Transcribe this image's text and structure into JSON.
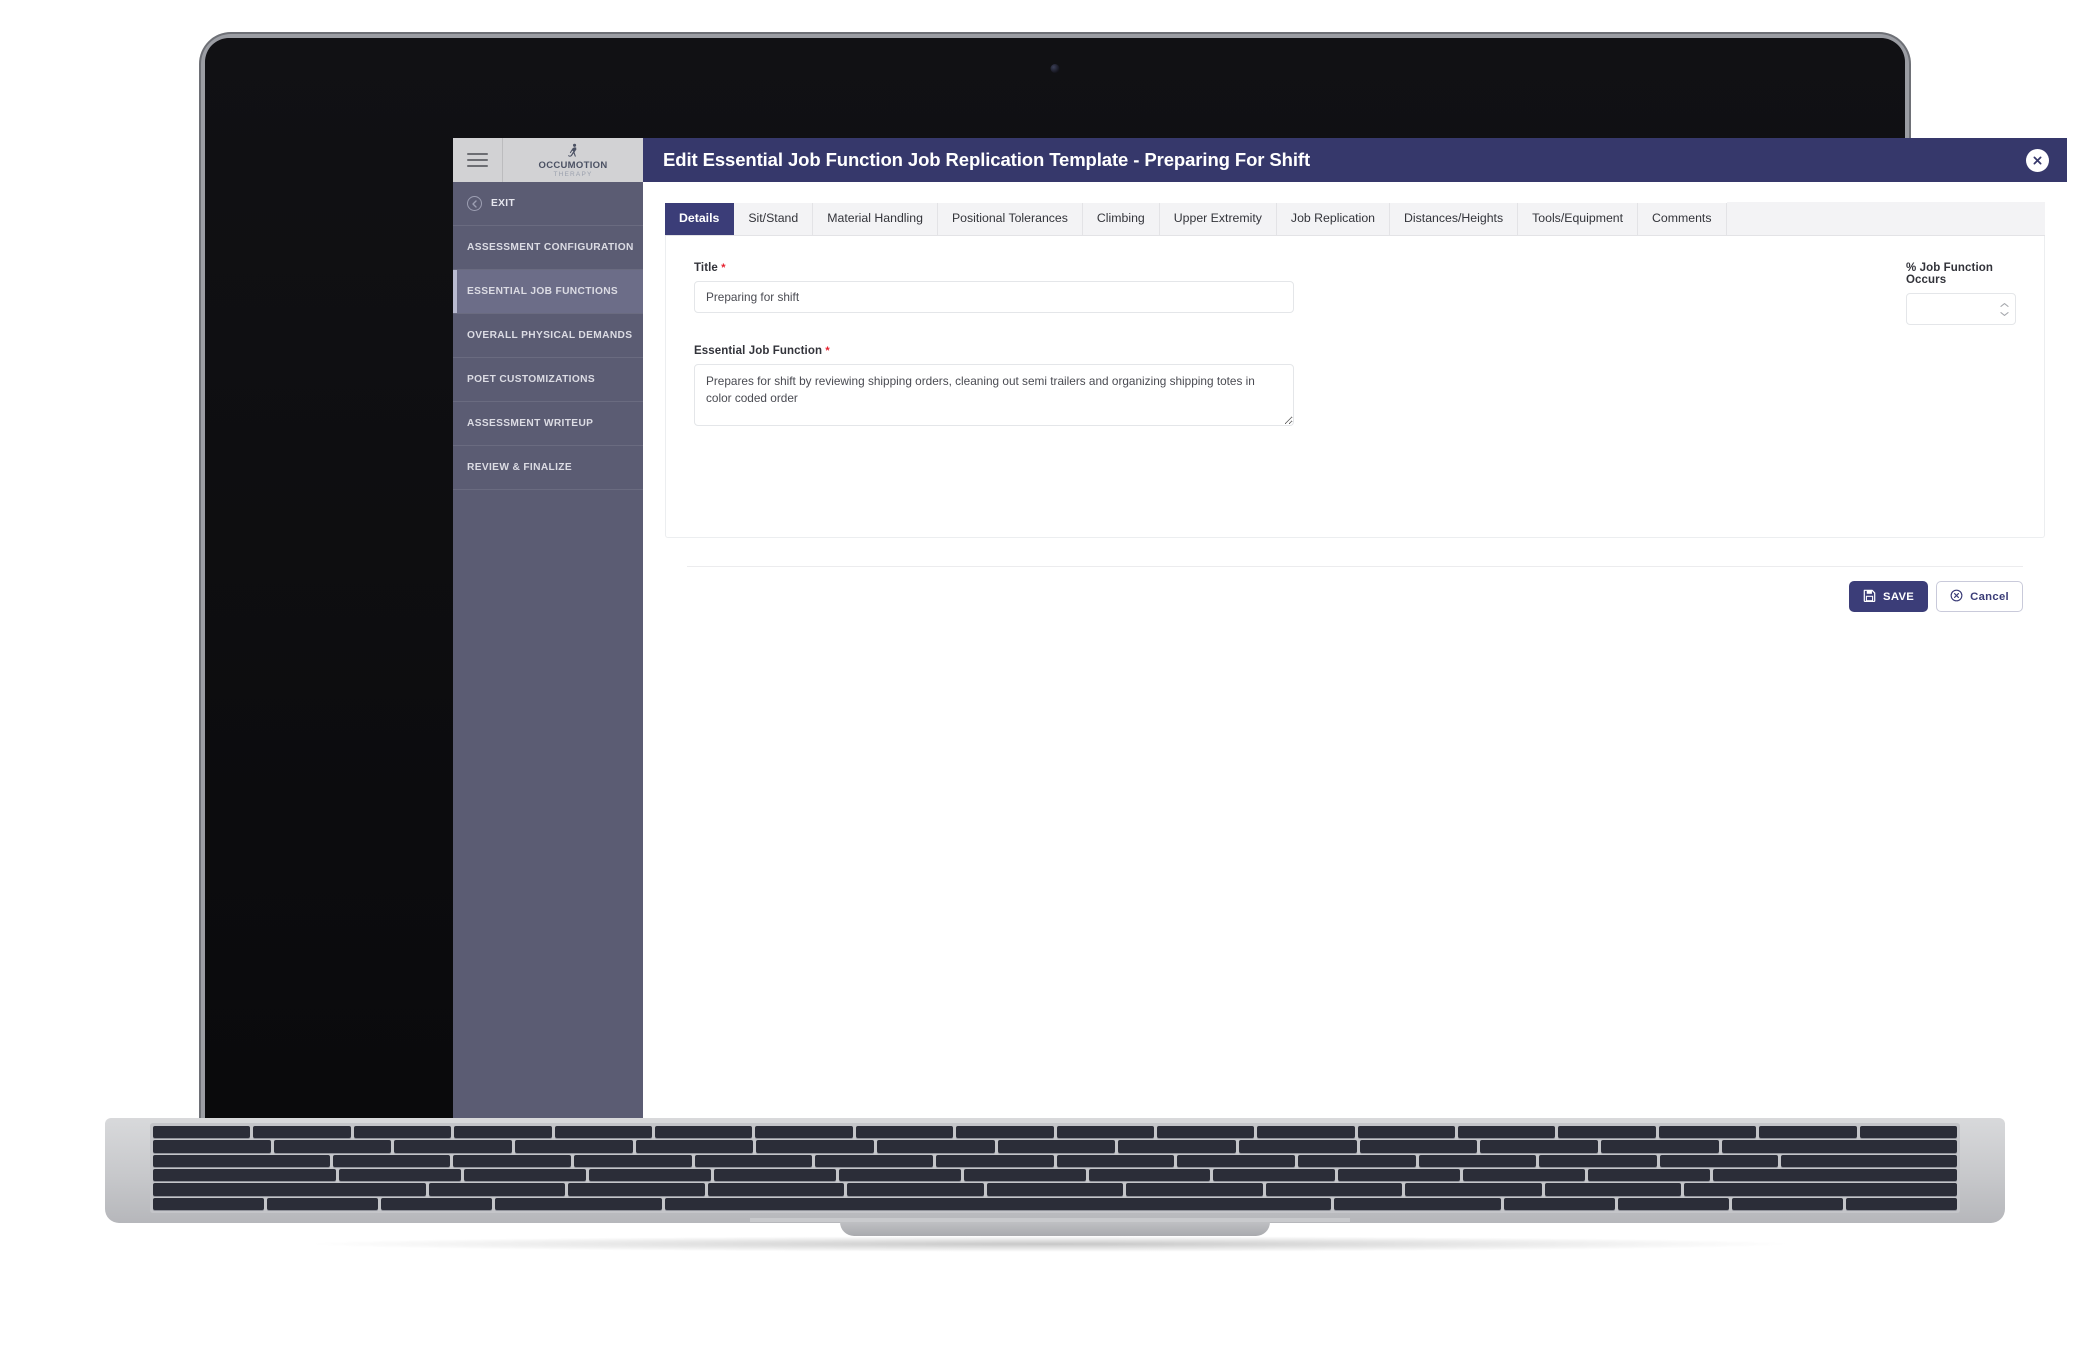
{
  "sidebar": {
    "brand": {
      "name": "OCCUMOTION",
      "tagline": "THERAPY",
      "logo_icon": "person-figure-icon"
    },
    "menu_icon": "hamburger-menu-icon",
    "items": [
      {
        "label": "EXIT",
        "icon": "back-arrow-circle-icon",
        "active": false
      },
      {
        "label": "ASSESSMENT CONFIGURATION",
        "active": false
      },
      {
        "label": "ESSENTIAL JOB FUNCTIONS",
        "active": true
      },
      {
        "label": "OVERALL PHYSICAL DEMANDS",
        "active": false
      },
      {
        "label": "POET CUSTOMIZATIONS",
        "active": false
      },
      {
        "label": "ASSESSMENT WRITEUP",
        "active": false
      },
      {
        "label": "REVIEW & FINALIZE",
        "active": false
      }
    ]
  },
  "titlebar": {
    "title": "Edit Essential Job Function Job Replication Template - Preparing For Shift",
    "close_icon": "close-x-icon",
    "background_color": "#36386b"
  },
  "tabs": [
    {
      "label": "Details",
      "active": true
    },
    {
      "label": "Sit/Stand",
      "active": false
    },
    {
      "label": "Material Handling",
      "active": false
    },
    {
      "label": "Positional Tolerances",
      "active": false
    },
    {
      "label": "Climbing",
      "active": false
    },
    {
      "label": "Upper Extremity",
      "active": false
    },
    {
      "label": "Job Replication",
      "active": false
    },
    {
      "label": "Distances/Heights",
      "active": false
    },
    {
      "label": "Tools/Equipment",
      "active": false
    },
    {
      "label": "Comments",
      "active": false
    }
  ],
  "form": {
    "title_field": {
      "label": "Title",
      "required_marker": "*",
      "value": "Preparing for shift",
      "placeholder": ""
    },
    "percent_field": {
      "label": "% Job Function Occurs",
      "required_marker": "",
      "value": "",
      "placeholder": "",
      "up_icon": "chevron-up-icon",
      "down_icon": "chevron-down-icon"
    },
    "function_field": {
      "label": "Essential Job Function",
      "required_marker": "*",
      "value": "Prepares for shift by reviewing shipping orders, cleaning out semi trailers and organizing shipping totes in color coded order",
      "placeholder": ""
    }
  },
  "actions": {
    "save_label": "SAVE",
    "save_icon": "floppy-disk-save-icon",
    "cancel_label": "Cancel",
    "cancel_icon": "cancel-x-circle-icon",
    "accent_color": "#3b3d78"
  }
}
